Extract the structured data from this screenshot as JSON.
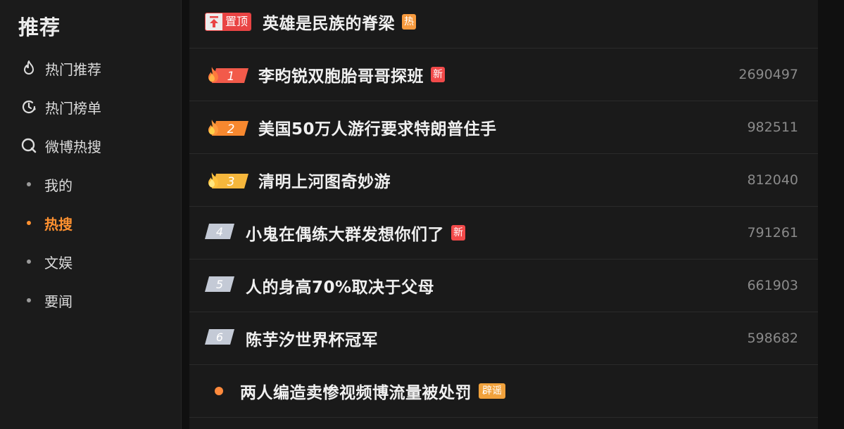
{
  "sidebar": {
    "title": "推荐",
    "nav": [
      {
        "label": "热门推荐",
        "icon": "flame-icon"
      },
      {
        "label": "热门榜单",
        "icon": "chart-clock-icon"
      },
      {
        "label": "微博热搜",
        "icon": "search-icon"
      }
    ],
    "sub": [
      {
        "label": "我的",
        "active": false
      },
      {
        "label": "热搜",
        "active": true
      },
      {
        "label": "文娱",
        "active": false
      },
      {
        "label": "要闻",
        "active": false
      }
    ]
  },
  "pinned": {
    "tag": "置顶",
    "title": "英雄是民族的脊梁",
    "badge": "热"
  },
  "list": [
    {
      "rank": "1",
      "title": "李昀锐双胞胎哥哥探班",
      "badge": "新",
      "count": "2690497"
    },
    {
      "rank": "2",
      "title": "美国50万人游行要求特朗普住手",
      "badge": "",
      "count": "982511"
    },
    {
      "rank": "3",
      "title": "清明上河图奇妙游",
      "badge": "",
      "count": "812040"
    },
    {
      "rank": "4",
      "title": "小鬼在偶练大群发想你们了",
      "badge": "新",
      "count": "791261"
    },
    {
      "rank": "5",
      "title": "人的身高70%取决于父母",
      "badge": "",
      "count": "661903"
    },
    {
      "rank": "6",
      "title": "陈芋汐世界杯冠军",
      "badge": "",
      "count": "598682"
    }
  ],
  "promo": {
    "title": "两人编造卖惨视频博流量被处罚",
    "badge": "辟谣"
  },
  "colors": {
    "accent": "#ff9130",
    "rank1": "#f25a4a",
    "rank2": "#f7882f",
    "rank3": "#f6b73c",
    "rankOther": "#c4cad6",
    "new": "#f24a4a",
    "hot": "#f79a3e"
  }
}
